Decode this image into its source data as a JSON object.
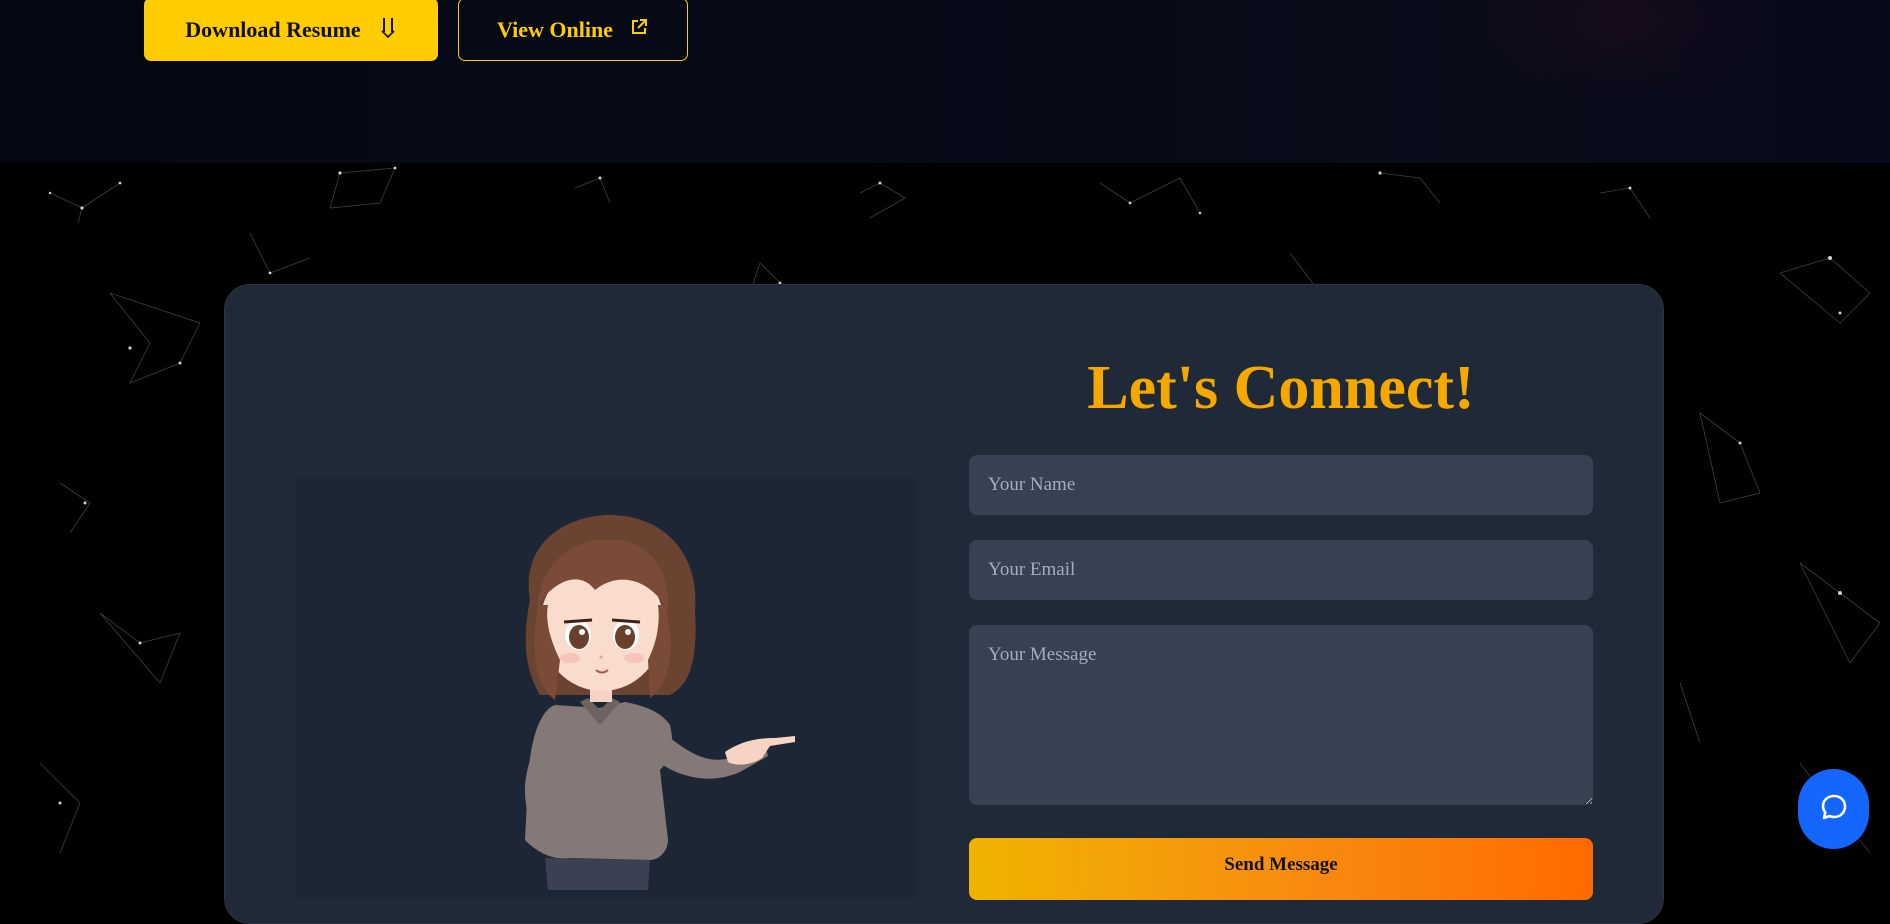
{
  "hero": {
    "download_button_label": "Download Resume",
    "view_button_label": "View Online",
    "download_icon": "arrows-down-icon",
    "external_icon": "external-link-icon"
  },
  "contact": {
    "heading": "Let's Connect!",
    "name_placeholder": "Your Name",
    "email_placeholder": "Your Email",
    "message_placeholder": "Your Message",
    "send_button_label": "Send Message"
  },
  "chat": {
    "icon": "chat-bubble-icon"
  },
  "colors": {
    "accent": "#ffcc00",
    "heading": "#f5a900",
    "card": "#1f2937",
    "field": "#374151",
    "chat": "#1565ff"
  }
}
